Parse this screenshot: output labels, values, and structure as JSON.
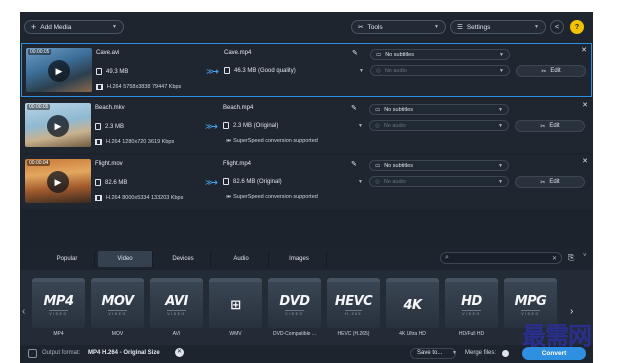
{
  "toolbar": {
    "add_media": "Add Media",
    "tools": "Tools",
    "settings": "Settings"
  },
  "files": [
    {
      "duration": "00:00:05",
      "thumb_class": "t1",
      "name": "Cave.avi",
      "size": "49.3 MB",
      "meta": "H.264 5758x3838 79447 Kbps",
      "output_name": "Cave.mp4",
      "output_size": "46.3 MB (Good quality)",
      "subtitles": "No subtitles",
      "audio": "No audio",
      "edit": "Edit",
      "superspeed": ""
    },
    {
      "duration": "00:00:05",
      "thumb_class": "t2",
      "name": "Beach.mkv",
      "size": "2.3 MB",
      "meta": "H.264 1280x720 3619 Kbps",
      "output_name": "Beach.mp4",
      "output_size": "2.3 MB (Original)",
      "subtitles": "No subtitles",
      "audio": "No audio",
      "edit": "Edit",
      "superspeed": "SuperSpeed conversion supported"
    },
    {
      "duration": "00:00:04",
      "thumb_class": "t3",
      "name": "Flight.mov",
      "size": "82.6 MB",
      "meta": "H.264 8000x5334 133203 Kbps",
      "output_name": "Flight.mp4",
      "output_size": "82.6 MB (Original)",
      "subtitles": "No subtitles",
      "audio": "No audio",
      "edit": "Edit",
      "superspeed": "SuperSpeed conversion supported"
    }
  ],
  "tabs": [
    "Popular",
    "Video",
    "Devices",
    "Audio",
    "Images"
  ],
  "active_tab": "Video",
  "formats": [
    {
      "logo": "MP4",
      "sub": "VIDEO",
      "label": "MP4"
    },
    {
      "logo": "MOV",
      "sub": "VIDEO",
      "label": "MOV"
    },
    {
      "logo": "AVI",
      "sub": "VIDEO",
      "label": "AVI"
    },
    {
      "logo": "⊞",
      "sub": "",
      "label": "WMV"
    },
    {
      "logo": "DVD",
      "sub": "VIDEO",
      "label": "DVD-Compatible ..."
    },
    {
      "logo": "HEVC",
      "sub": "H.265",
      "label": "HEVC (H.265)"
    },
    {
      "logo": "4K",
      "sub": "",
      "label": "4K Ultra HD"
    },
    {
      "logo": "HD",
      "sub": "VIDEO",
      "label": "HD/Full HD"
    },
    {
      "logo": "MPG",
      "sub": "VIDEO",
      "label": ""
    }
  ],
  "footer": {
    "output_format_label": "Output format:",
    "output_format_value": "MP4 H.264 - Original Size",
    "save_to": "Save to...",
    "merge_files": "Merge files:",
    "convert": "Convert"
  },
  "watermark": "最需网",
  "colors": {
    "accent": "#2f8fe0",
    "background": "#1c232d",
    "watermark": "#2a2f8f"
  }
}
